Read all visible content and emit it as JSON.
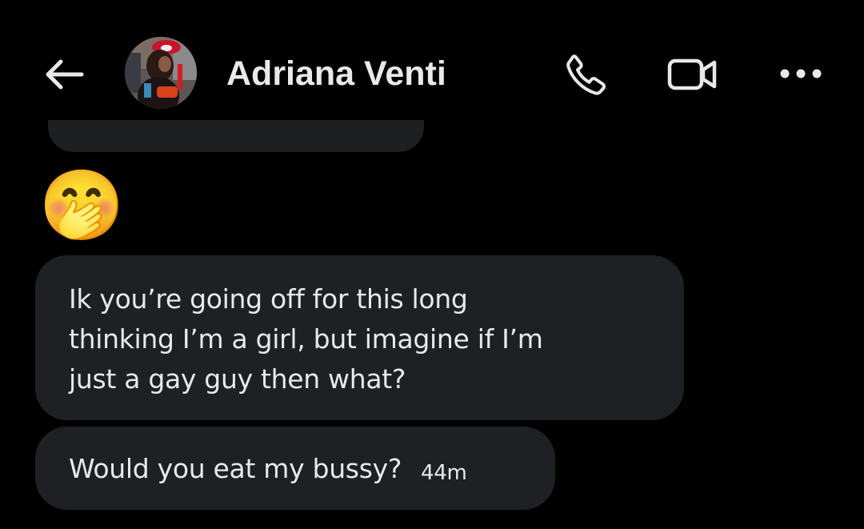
{
  "header": {
    "contact_name": "Adriana Venti",
    "back_icon": "arrow-left-icon",
    "call_icon": "phone-icon",
    "video_icon": "video-camera-icon",
    "more_icon": "more-horizontal-icon",
    "icon_color": "#e7e9ea"
  },
  "messages": [
    {
      "type": "emoji",
      "text": "🤭"
    },
    {
      "type": "text",
      "lines": [
        "Ik you’re going off for this long",
        "thinking I’m a girl, but imagine if I’m",
        "just a gay guy then what?"
      ]
    },
    {
      "type": "text",
      "text": "Would you eat my bussy?",
      "timestamp": "44m"
    }
  ],
  "colors": {
    "background": "#000000",
    "bubble": "#1e2023",
    "text": "#e7e9ea"
  }
}
